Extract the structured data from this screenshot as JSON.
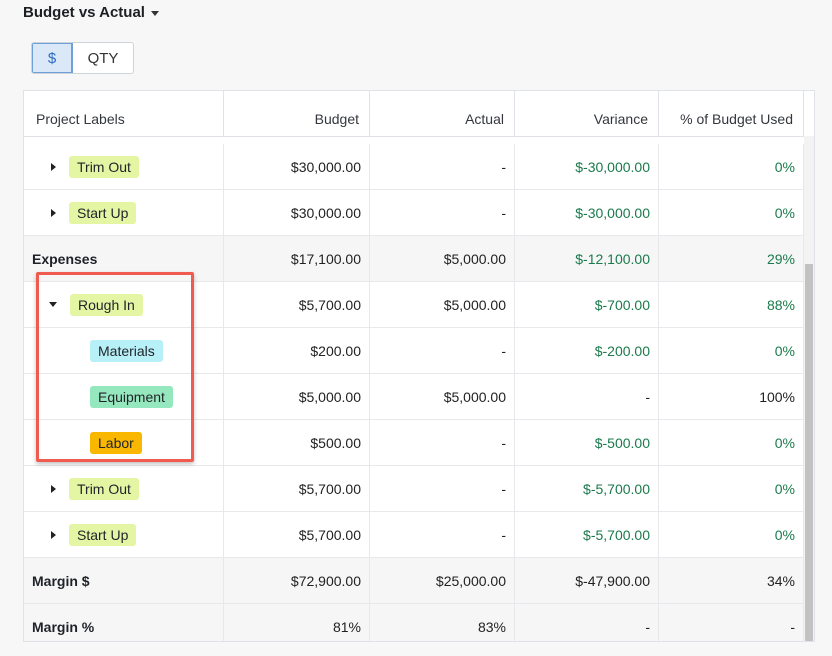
{
  "title": "Budget vs Actual",
  "toggle": {
    "dollar": "$",
    "qty": "QTY"
  },
  "columns": [
    "Project Labels",
    "Budget",
    "Actual",
    "Variance",
    "% of Budget Used"
  ],
  "rows": [
    {
      "label": "Trim Out",
      "budget": "$30,000.00",
      "actual": "-",
      "variance": "$-30,000.00",
      "pct": "0%"
    },
    {
      "label": "Start Up",
      "budget": "$30,000.00",
      "actual": "-",
      "variance": "$-30,000.00",
      "pct": "0%"
    },
    {
      "label": "Expenses",
      "budget": "$17,100.00",
      "actual": "$5,000.00",
      "variance": "$-12,100.00",
      "pct": "29%"
    },
    {
      "label": "Rough In",
      "budget": "$5,700.00",
      "actual": "$5,000.00",
      "variance": "$-700.00",
      "pct": "88%"
    },
    {
      "label": "Materials",
      "budget": "$200.00",
      "actual": "-",
      "variance": "$-200.00",
      "pct": "0%"
    },
    {
      "label": "Equipment",
      "budget": "$5,000.00",
      "actual": "$5,000.00",
      "variance": "-",
      "pct": "100%"
    },
    {
      "label": "Labor",
      "budget": "$500.00",
      "actual": "-",
      "variance": "$-500.00",
      "pct": "0%"
    },
    {
      "label": "Trim Out",
      "budget": "$5,700.00",
      "actual": "-",
      "variance": "$-5,700.00",
      "pct": "0%"
    },
    {
      "label": "Start Up",
      "budget": "$5,700.00",
      "actual": "-",
      "variance": "$-5,700.00",
      "pct": "0%"
    },
    {
      "label": "Margin $",
      "budget": "$72,900.00",
      "actual": "$25,000.00",
      "variance": "$-47,900.00",
      "pct": "34%"
    },
    {
      "label": "Margin %",
      "budget": "81%",
      "actual": "83%",
      "variance": "-",
      "pct": "-"
    }
  ],
  "colors": {
    "positive_green": "#1b7a4c",
    "tag_lime": "#e4f5a4",
    "tag_cyan": "#b7f0f6",
    "tag_mint": "#95e7bd",
    "tag_orange": "#f9b700",
    "highlight_red": "#ef5b4f"
  }
}
